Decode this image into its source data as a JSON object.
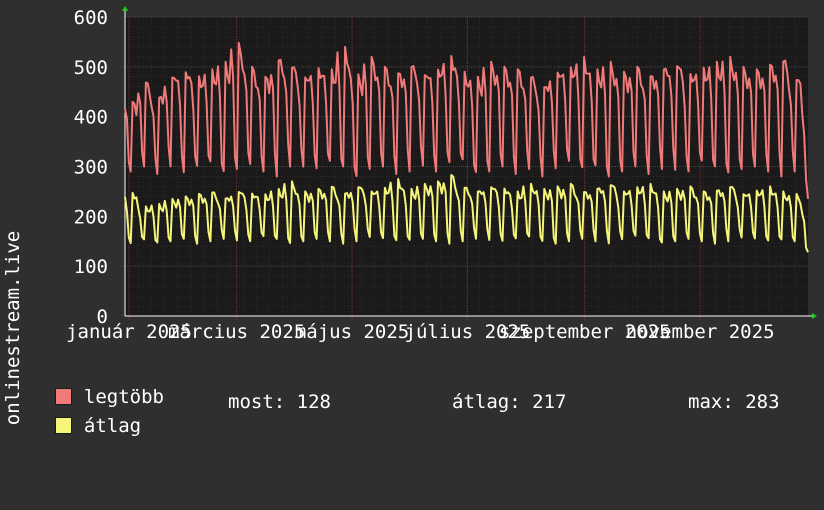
{
  "chart_data": {
    "type": "line",
    "ylabel": "onlinestream.live",
    "ylim": [
      0,
      600
    ],
    "yticks": [
      "0",
      "100",
      "200",
      "300",
      "400",
      "500",
      "600"
    ],
    "xticks": [
      "január 2025",
      "március 2025",
      "május 2025",
      "július 2025",
      "szeptember 2025",
      "november 2025"
    ],
    "grid": true,
    "legend_placement": "bottom-left",
    "x_range": [
      "2025-01-01",
      "2025-12-28"
    ],
    "series": [
      {
        "name": "legtöbb",
        "color": "#f07a7a",
        "weekly_low": [
          290,
          300,
          285,
          300,
          280,
          290,
          300,
          285,
          295,
          305,
          290,
          280,
          300,
          295,
          285,
          300,
          290,
          280,
          295,
          300,
          285,
          290,
          300,
          280,
          295,
          305,
          285,
          290,
          300,
          285,
          295,
          280,
          290,
          300,
          285,
          295,
          280,
          290,
          300,
          285,
          295,
          290,
          280,
          300,
          290,
          285,
          295,
          300,
          290,
          280,
          290,
          235
        ],
        "weekly_high": [
          430,
          470,
          445,
          490,
          500,
          485,
          495,
          510,
          548,
          500,
          480,
          520,
          510,
          490,
          505,
          495,
          540,
          485,
          520,
          500,
          490,
          510,
          495,
          505,
          525,
          490,
          480,
          510,
          500,
          495,
          485,
          470,
          500,
          505,
          520,
          495,
          510,
          490,
          500,
          485,
          505,
          515,
          495,
          500,
          510,
          520,
          500,
          495,
          505,
          520,
          485,
          430
        ]
      },
      {
        "name": "átlag",
        "color": "#f5f57a",
        "weekly_low": [
          140,
          150,
          145,
          150,
          155,
          145,
          150,
          155,
          150,
          145,
          155,
          150,
          145,
          150,
          155,
          150,
          145,
          150,
          155,
          150,
          145,
          150,
          155,
          150,
          145,
          150,
          155,
          150,
          145,
          150,
          155,
          150,
          145,
          150,
          155,
          150,
          145,
          150,
          155,
          150,
          145,
          150,
          155,
          150,
          145,
          150,
          155,
          150,
          145,
          150,
          150,
          128
        ],
        "weekly_high": [
          250,
          220,
          225,
          235,
          240,
          245,
          250,
          240,
          255,
          250,
          245,
          255,
          270,
          250,
          255,
          260,
          250,
          265,
          255,
          260,
          275,
          255,
          265,
          270,
          283,
          260,
          255,
          265,
          260,
          250,
          265,
          255,
          260,
          265,
          250,
          260,
          270,
          255,
          260,
          265,
          250,
          255,
          260,
          250,
          255,
          265,
          250,
          255,
          260,
          250,
          245,
          210
        ]
      }
    ]
  },
  "legend": [
    {
      "label": "legtöbb",
      "color": "#f07a7a"
    },
    {
      "label": "átlag",
      "color": "#f5f57a"
    }
  ],
  "stats": {
    "most": "most: 128",
    "atlag": "átlag: 217",
    "max": "max: 283"
  },
  "colors": {
    "background": "#2f2f2f",
    "plot_background": "#1a1a1a",
    "grid": "#5a2a2a",
    "axis_arrow": "#22cc22"
  }
}
